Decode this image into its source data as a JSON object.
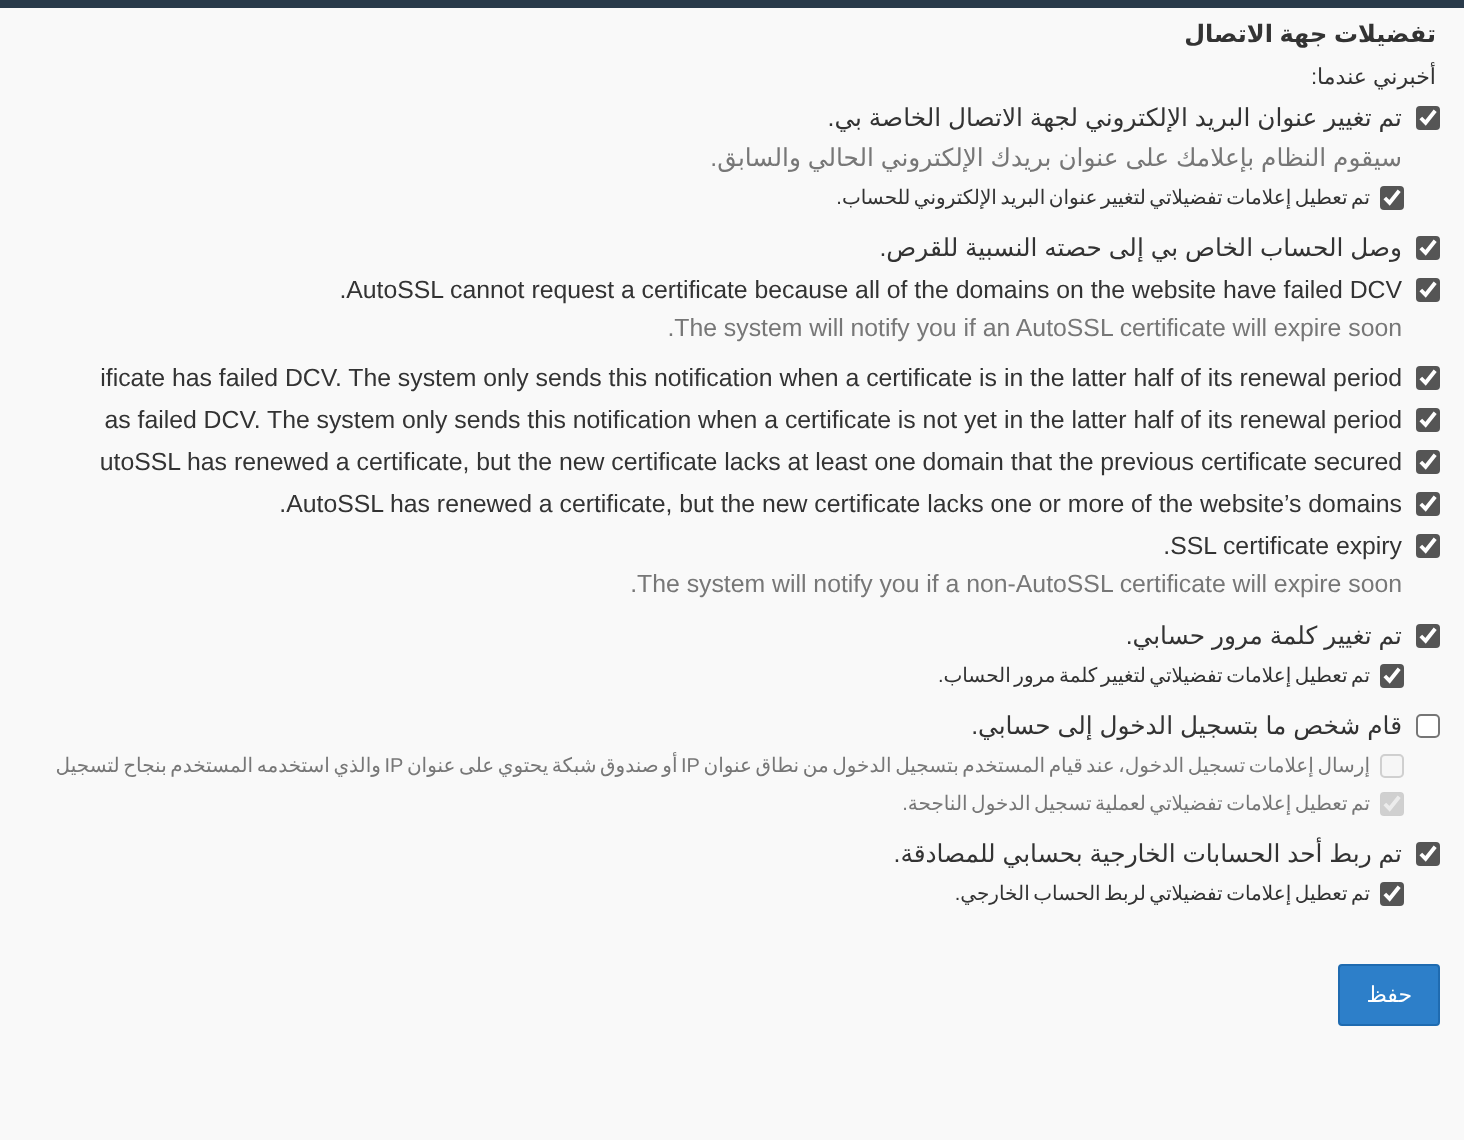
{
  "title": "تفضيلات جهة الاتصال",
  "prompt": "أخبرني عندما:",
  "items": [
    {
      "label": "تم تغيير عنوان البريد الإلكتروني لجهة الاتصال الخاصة بي.",
      "checked": true,
      "disabled": false,
      "description": "سيقوم النظام بإعلامك على عنوان بريدك الإلكتروني الحالي والسابق.",
      "children": [
        {
          "label": "تم تعطيل إعلامات تفضيلاتي لتغيير عنوان البريد الإلكتروني للحساب.",
          "checked": true,
          "disabled": false
        }
      ]
    },
    {
      "label": "وصل الحساب الخاص بي إلى حصته النسبية للقرص.",
      "checked": true,
      "disabled": false
    },
    {
      "label": "AutoSSL cannot request a certificate because all of the domains on the website have failed DCV.",
      "checked": true,
      "disabled": false,
      "description": "The system will notify you if an AutoSSL certificate will expire soon."
    },
    {
      "label": "ificate has failed DCV. The system only sends this notification when a certificate is in the latter half of its renewal period",
      "checked": true,
      "disabled": false
    },
    {
      "label": "as failed DCV. The system only sends this notification when a certificate is not yet in the latter half of its renewal period",
      "checked": true,
      "disabled": false
    },
    {
      "label": "utoSSL has renewed a certificate, but the new certificate lacks at least one domain that the previous certificate secured",
      "checked": true,
      "disabled": false
    },
    {
      "label": "AutoSSL has renewed a certificate, but the new certificate lacks one or more of the website’s domains.",
      "checked": true,
      "disabled": false
    },
    {
      "label": "SSL certificate expiry.",
      "checked": true,
      "disabled": false,
      "description": "The system will notify you if a non-AutoSSL certificate will expire soon."
    },
    {
      "label": "تم تغيير كلمة مرور حسابي.",
      "checked": true,
      "disabled": false,
      "children": [
        {
          "label": "تم تعطيل إعلامات تفضيلاتي لتغيير كلمة مرور الحساب.",
          "checked": true,
          "disabled": false
        }
      ]
    },
    {
      "label": "قام شخص ما بتسجيل الدخول إلى حسابي.",
      "checked": false,
      "disabled": false,
      "children": [
        {
          "label": "إرسال إعلامات تسجيل الدخول، عند قيام المستخدم بتسجيل الدخول من نطاق عنوان IP أو صندوق شبكة يحتوي على عنوان IP والذي استخدمه المستخدم بنجاح لتسجيل",
          "checked": false,
          "disabled": true
        },
        {
          "label": "تم تعطيل إعلامات تفضيلاتي لعملية تسجيل الدخول الناجحة.",
          "checked": true,
          "disabled": true
        }
      ]
    },
    {
      "label": "تم ربط أحد الحسابات الخارجية بحسابي للمصادقة.",
      "checked": true,
      "disabled": false,
      "children": [
        {
          "label": "تم تعطيل إعلامات تفضيلاتي لربط الحساب الخارجي.",
          "checked": true,
          "disabled": false
        }
      ]
    }
  ],
  "save_button": "حفظ"
}
